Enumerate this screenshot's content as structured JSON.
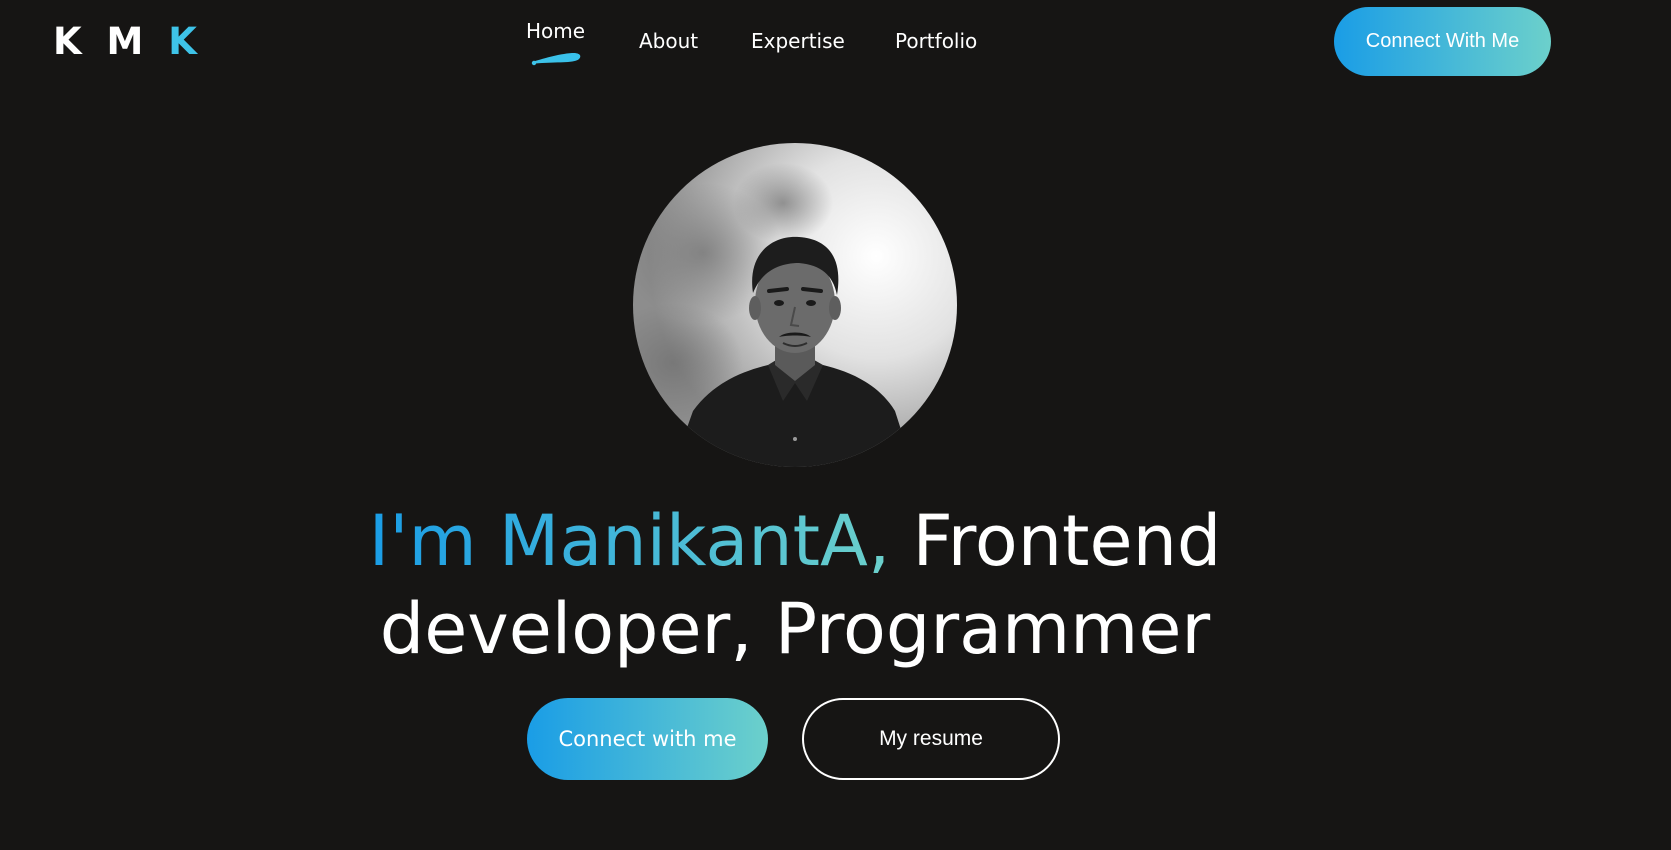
{
  "header": {
    "logo": {
      "part1": "K M ",
      "part2": "K"
    },
    "nav": [
      {
        "label": "Home",
        "active": true
      },
      {
        "label": "About"
      },
      {
        "label": "Expertise"
      },
      {
        "label": "Portfolio"
      }
    ],
    "cta_label": "Connect With Me"
  },
  "hero": {
    "headline_name": "I'm ManikantA,",
    "headline_line1_rest": " Frontend",
    "headline_line2": "developer, Programmer",
    "primary_button": "Connect with me",
    "secondary_button": "My resume"
  },
  "colors": {
    "background": "#161514",
    "accent_start": "#1a9de6",
    "accent_end": "#6cd0cb"
  },
  "icons": {
    "nav_underline": "brush-stroke-icon",
    "avatar": "profile-photo"
  }
}
